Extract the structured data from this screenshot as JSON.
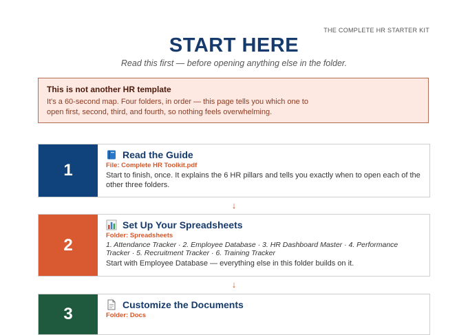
{
  "header": {
    "kit_label": "THE COMPLETE HR STARTER KIT",
    "title": "START HERE",
    "subtitle": "Read this first — before opening anything else in the folder."
  },
  "callout": {
    "heading": "This is not another HR template",
    "body": "It's a 60-second map. Four folders, in order — this page tells you which one to open first, second, third, and fourth, so nothing feels overwhelming."
  },
  "colors": {
    "navy": "#10427b",
    "orange": "#d95a30",
    "green": "#1f5a3f"
  },
  "steps": [
    {
      "number": "1",
      "icon": "book-icon",
      "title": "Read the Guide",
      "source": "File: Complete HR Toolkit.pdf",
      "description": "Start to finish, once. It explains the 6 HR pillars and tells you exactly when to open each of the other three folders."
    },
    {
      "number": "2",
      "icon": "bar-chart-icon",
      "title": "Set Up Your Spreadsheets",
      "source": "Folder: Spreadsheets",
      "items": "1. Attendance Tracker · 2. Employee Database · 3. HR Dashboard Master · 4. Performance Tracker · 5. Recruitment Tracker · 6. Training Tracker",
      "description": "Start with Employee Database — everything else in this folder builds on it."
    },
    {
      "number": "3",
      "icon": "document-icon",
      "title": "Customize the Documents",
      "source": "Folder: Docs"
    }
  ],
  "arrows": [
    "↓",
    "↓"
  ]
}
